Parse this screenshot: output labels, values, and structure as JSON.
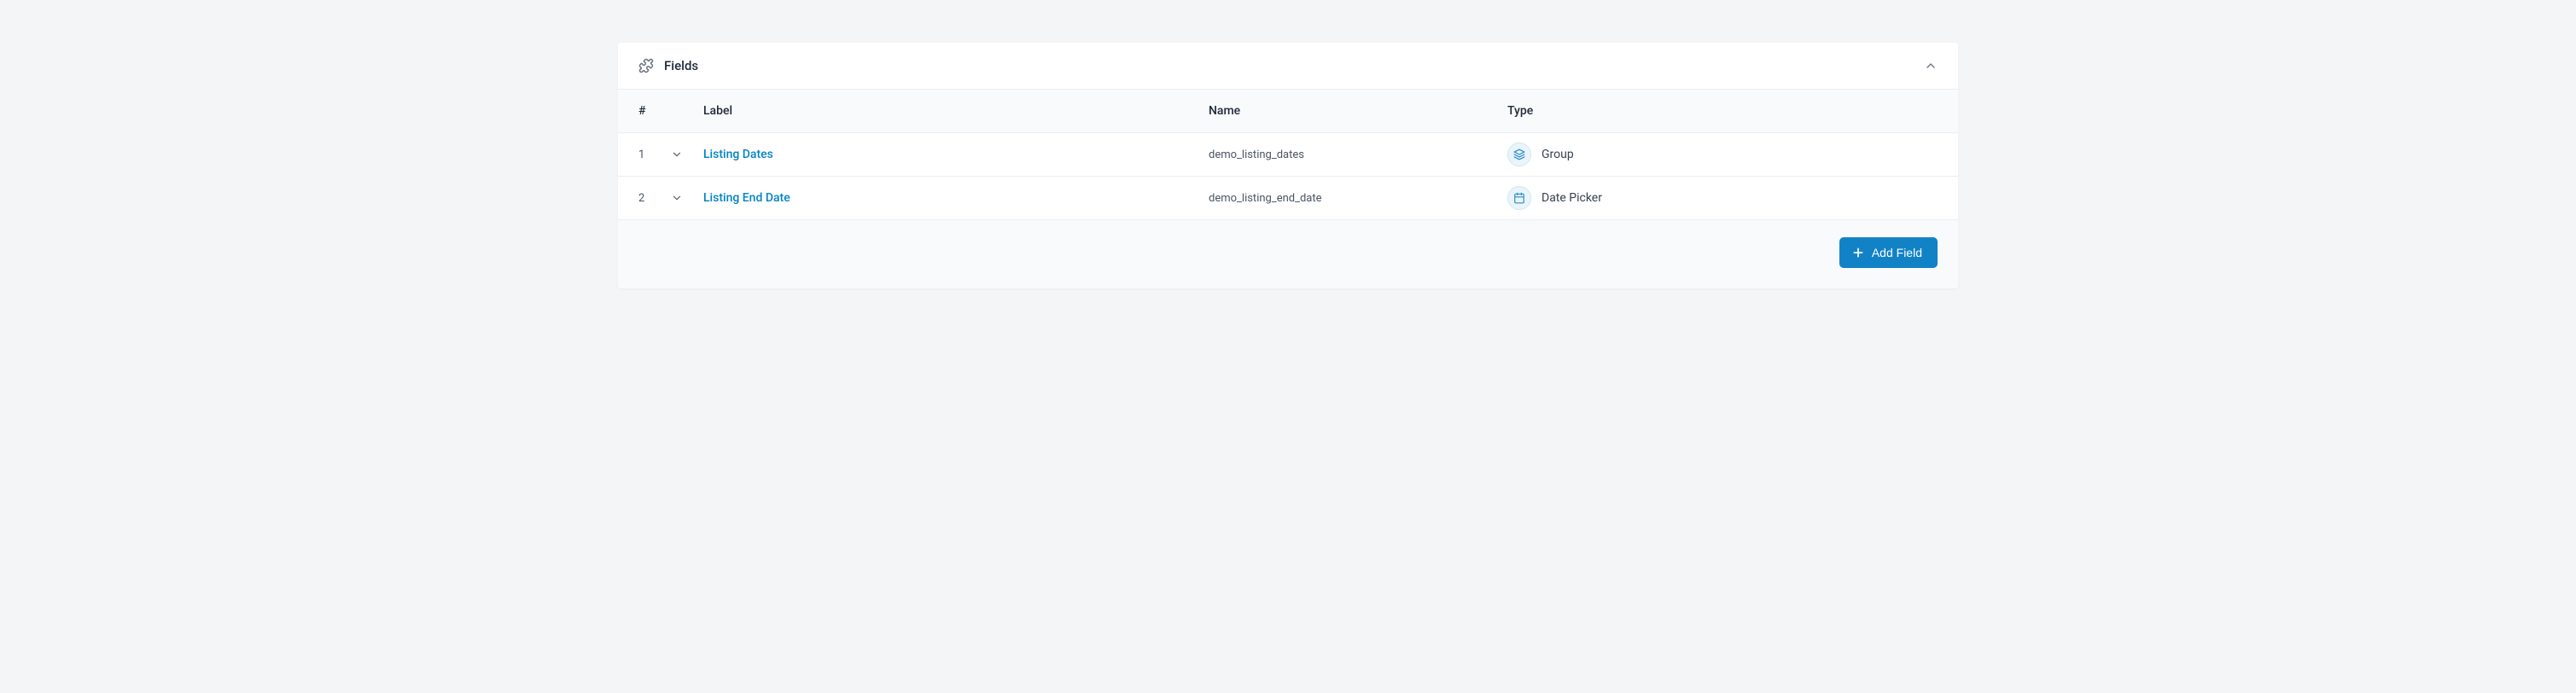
{
  "panel": {
    "title": "Fields"
  },
  "columns": {
    "order": "#",
    "label": "Label",
    "name": "Name",
    "type": "Type"
  },
  "rows": [
    {
      "order": "1",
      "label": "Listing Dates",
      "name": "demo_listing_dates",
      "type": "Group",
      "type_icon": "layers"
    },
    {
      "order": "2",
      "label": "Listing End Date",
      "name": "demo_listing_end_date",
      "type": "Date Picker",
      "type_icon": "calendar"
    }
  ],
  "footer": {
    "add_field": "Add Field"
  }
}
